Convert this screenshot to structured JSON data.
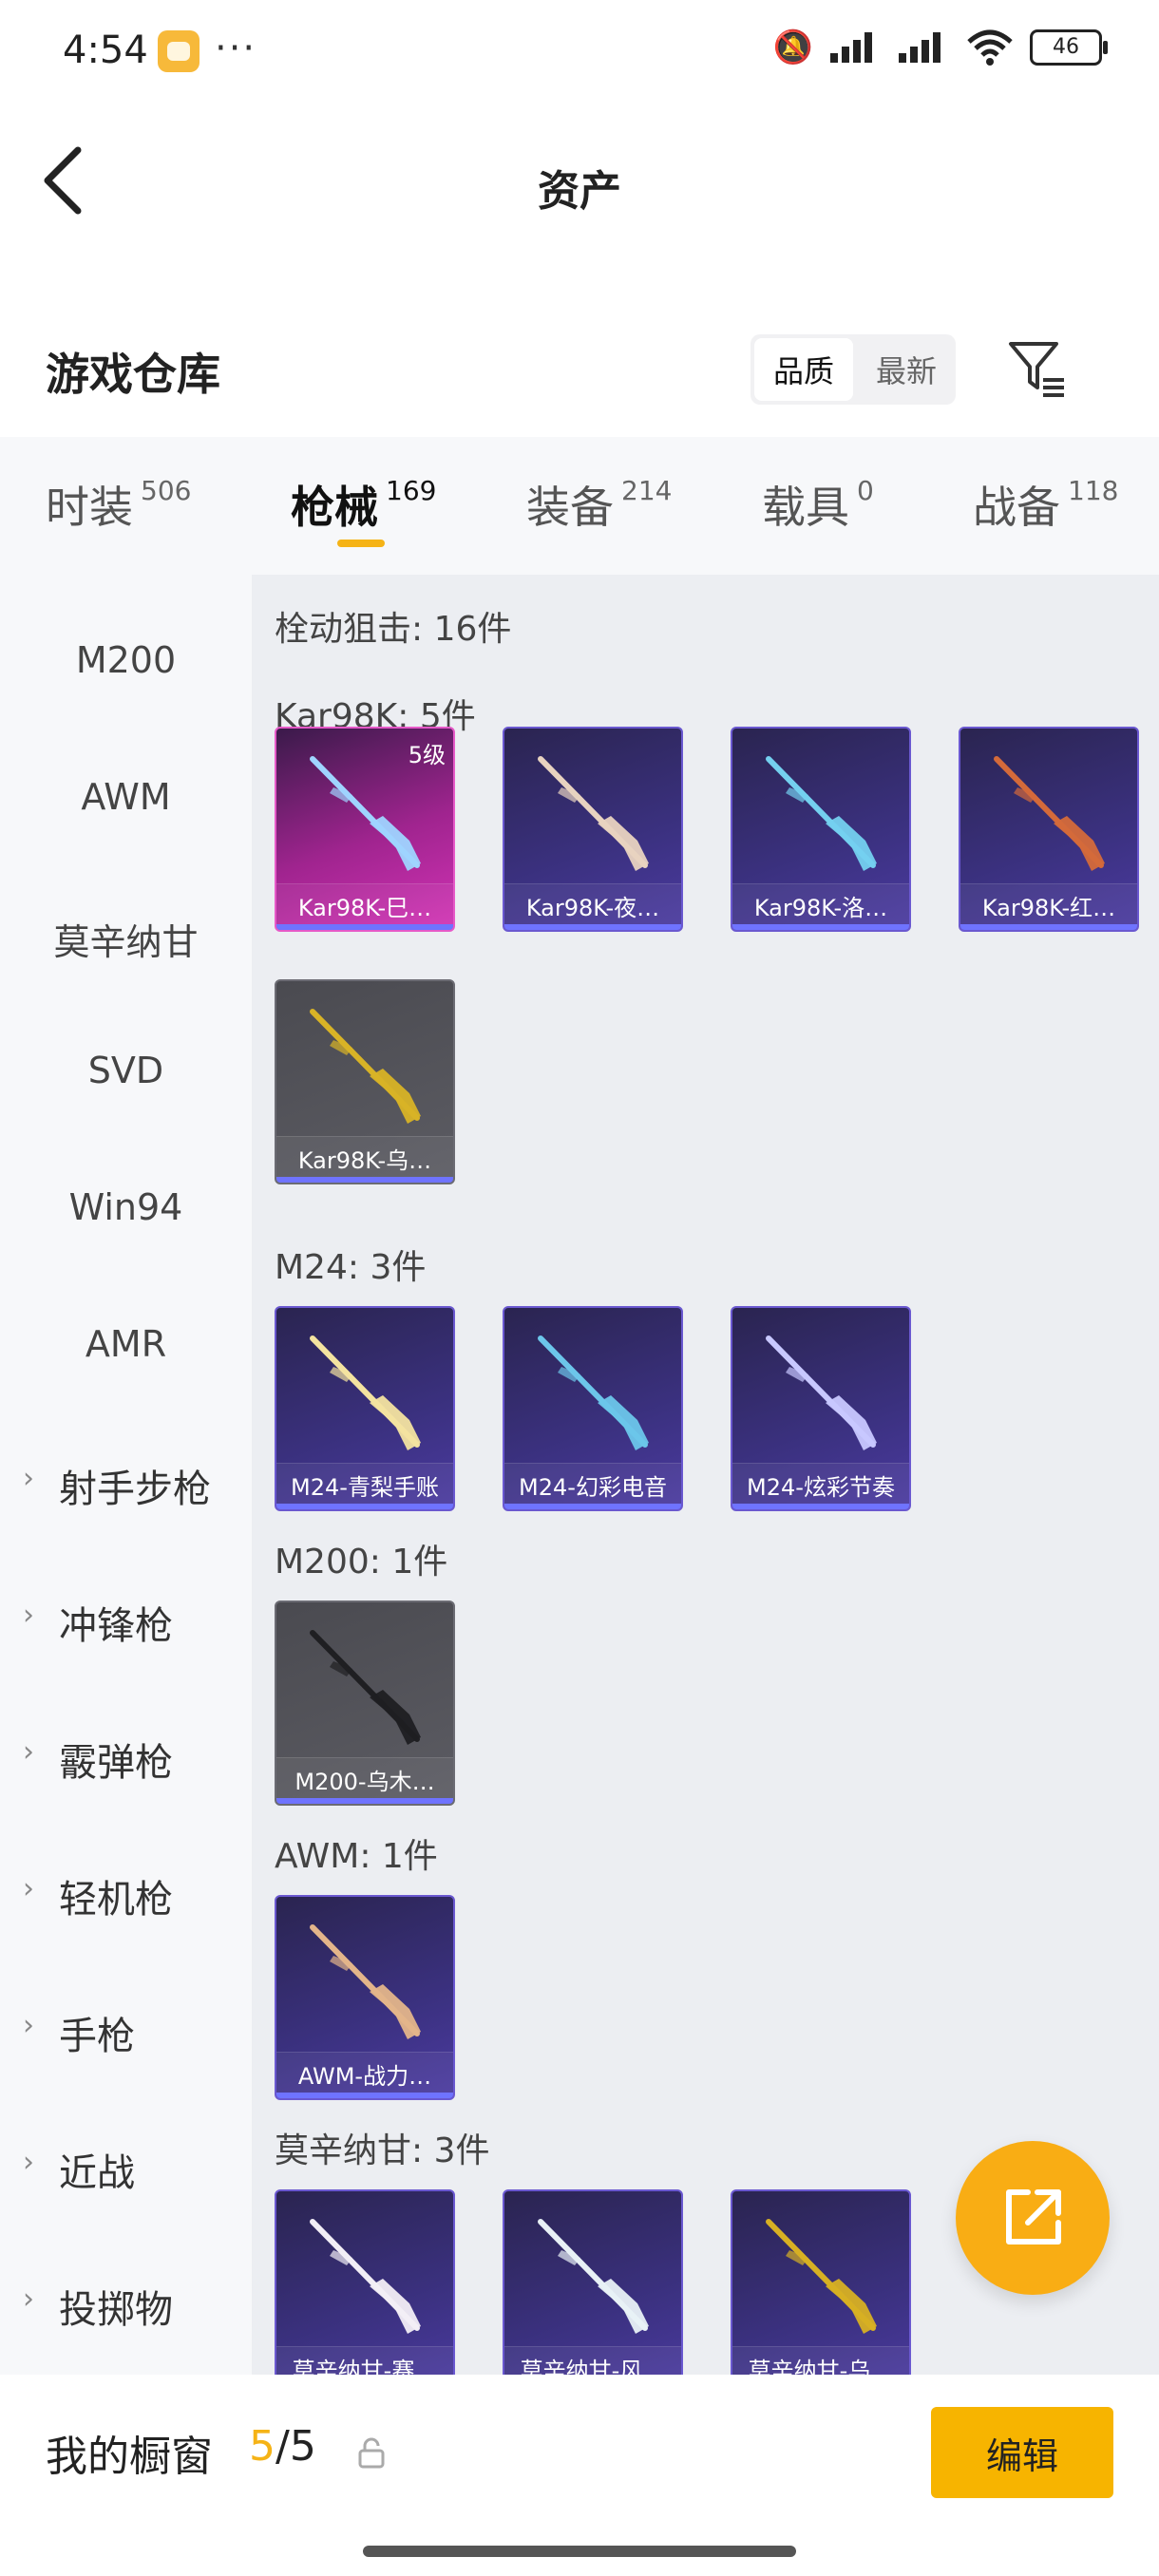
{
  "status_bar": {
    "time": "4:54",
    "dots": "···",
    "battery": "46"
  },
  "header": {
    "title": "资产"
  },
  "warehouse": {
    "title": "游戏仓库",
    "sort_options": [
      "品质",
      "最新"
    ]
  },
  "tabs": [
    {
      "label": "时装",
      "count": "506"
    },
    {
      "label": "枪械",
      "count": "169"
    },
    {
      "label": "装备",
      "count": "214"
    },
    {
      "label": "载具",
      "count": "0"
    },
    {
      "label": "战备",
      "count": "118"
    }
  ],
  "sidebar": {
    "items": [
      "M200",
      "AWM",
      "莫辛纳甘",
      "SVD",
      "Win94",
      "AMR"
    ],
    "groups": [
      "射手步枪",
      "冲锋枪",
      "霰弹枪",
      "轻机枪",
      "手枪",
      "近战",
      "投掷物"
    ]
  },
  "main": {
    "category_label": "栓动狙击: 16件",
    "sections": [
      {
        "label": "Kar98K: 5件",
        "items": [
          {
            "name": "Kar98K-巳…",
            "level": "5级",
            "style": "pink",
            "gun_color": "#9fd4ff"
          },
          {
            "name": "Kar98K-夜…",
            "style": "purple",
            "gun_color": "#e8d3c0"
          },
          {
            "name": "Kar98K-洛…",
            "style": "purple",
            "gun_color": "#74d0ef"
          },
          {
            "name": "Kar98K-红…",
            "style": "purple",
            "gun_color": "#d46a3a"
          },
          {
            "name": "Kar98K-乌…",
            "style": "gray",
            "gun_color": "#d8b326"
          }
        ]
      },
      {
        "label": "M24: 3件",
        "items": [
          {
            "name": "M24-青梨手账",
            "style": "purple",
            "gun_color": "#f3e3a0"
          },
          {
            "name": "M24-幻彩电音",
            "style": "purple",
            "gun_color": "#6cc6ea"
          },
          {
            "name": "M24-炫彩节奏",
            "style": "purple",
            "gun_color": "#c8c8ff"
          }
        ]
      },
      {
        "label": "M200: 1件",
        "items": [
          {
            "name": "M200-乌木…",
            "style": "gray",
            "gun_color": "#1f1f22"
          }
        ]
      },
      {
        "label": "AWM: 1件",
        "items": [
          {
            "name": "AWM-战力…",
            "style": "purple",
            "gun_color": "#e3b58a"
          }
        ]
      },
      {
        "label": "莫辛纳甘: 3件",
        "items": [
          {
            "name": "莫辛纳甘-赛…",
            "style": "purple",
            "gun_color": "#f2eef6"
          },
          {
            "name": "莫辛纳甘-风…",
            "style": "purple",
            "gun_color": "#e8f1f6"
          },
          {
            "name": "莫辛纳甘-乌…",
            "style": "purple",
            "gun_color": "#d7b023"
          }
        ]
      }
    ]
  },
  "bottom_bar": {
    "label": "我的橱窗",
    "count_current": "5",
    "count_total": "/5",
    "edit_label": "编辑"
  }
}
